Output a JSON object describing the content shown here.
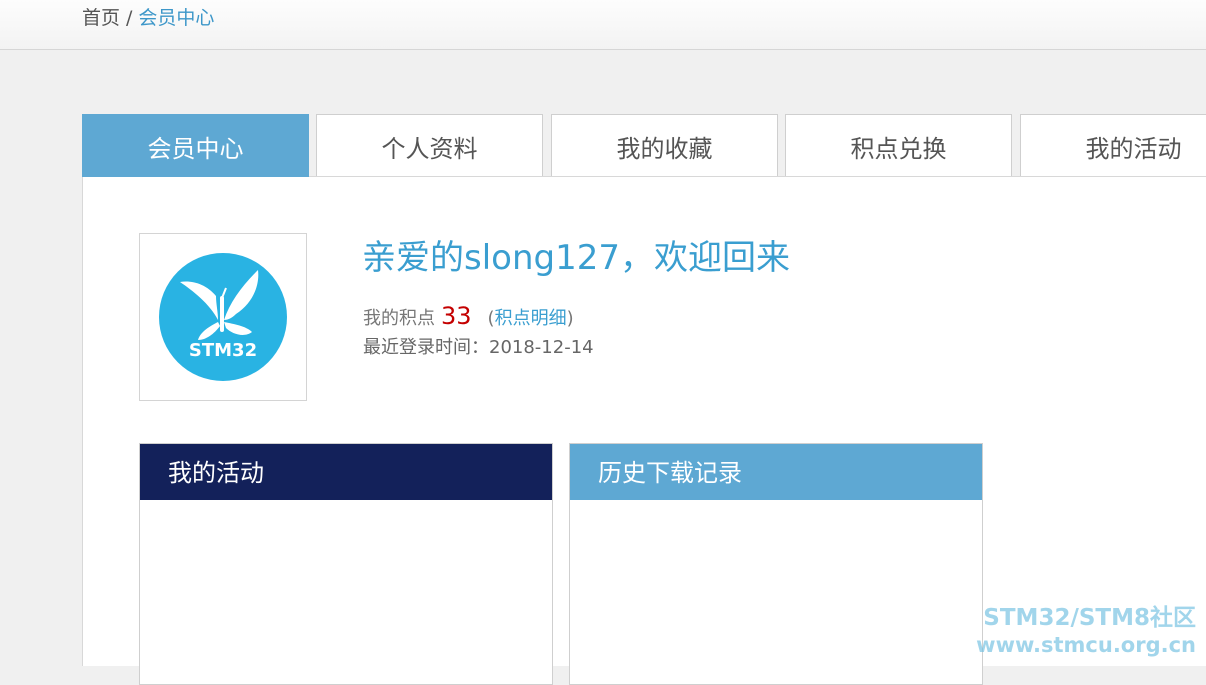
{
  "breadcrumb": {
    "home": "首页",
    "separator": "/",
    "current": "会员中心"
  },
  "tabs": [
    {
      "label": "会员中心",
      "active": true
    },
    {
      "label": "个人资料",
      "active": false
    },
    {
      "label": "我的收藏",
      "active": false
    },
    {
      "label": "积点兑换",
      "active": false
    },
    {
      "label": "我的活动",
      "active": false
    }
  ],
  "profile": {
    "avatar_text": "STM32",
    "welcome": "亲爱的slong127，欢迎回来",
    "points_label": "我的积点",
    "points_value": "33",
    "points_detail_open": "(",
    "points_detail_link": "积点明细",
    "points_detail_close": ")",
    "last_login": "最近登录时间：2018-12-14"
  },
  "cards": {
    "my_activities": "我的活动",
    "download_history": "历史下载记录"
  },
  "watermark": {
    "line1": "STM32/STM8社区",
    "line2": "www.stmcu.org.cn"
  },
  "colors": {
    "accent": "#5ea8d3",
    "dark_header": "#13215a",
    "points": "#c40000",
    "link": "#3a9ed0"
  }
}
